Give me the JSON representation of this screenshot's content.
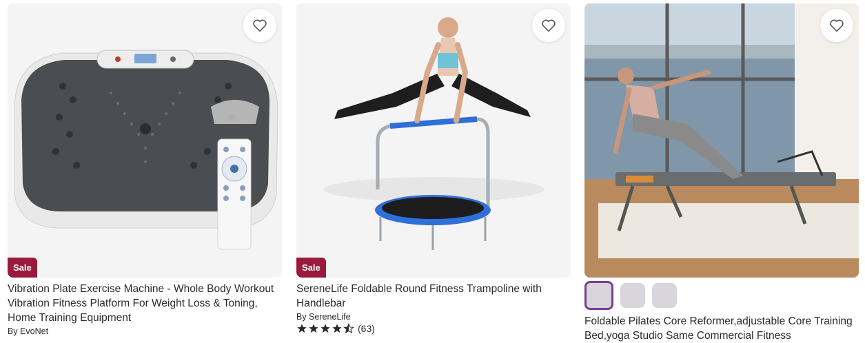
{
  "products": [
    {
      "title": "Vibration Plate Exercise Machine - Whole Body Workout Vibration Fitness Platform For Weight Loss & Toning, Home Training Equipment",
      "badge": "Sale",
      "brand": "By EvoNet",
      "image_icon": "vibration-plate-image"
    },
    {
      "title": "SereneLife Foldable Round Fitness Trampoline with Handlebar",
      "badge": "Sale",
      "brand": "By SereneLife",
      "rating": 4.5,
      "review_count": "(63)",
      "image_icon": "trampoline-image"
    },
    {
      "title": "Foldable Pilates Core Reformer,adjustable Core Training Bed,yoga Studio Same Commercial Fitness",
      "swatch_count": 3,
      "image_icon": "pilates-reformer-image"
    }
  ],
  "colors": {
    "sale_badge": "#9b1a3c",
    "star": "#2b2b2b",
    "swatch_selected_border": "#7a3e96",
    "swatch_fill": "#d8d6dc"
  },
  "favorite_icon": "heart-outline-icon"
}
